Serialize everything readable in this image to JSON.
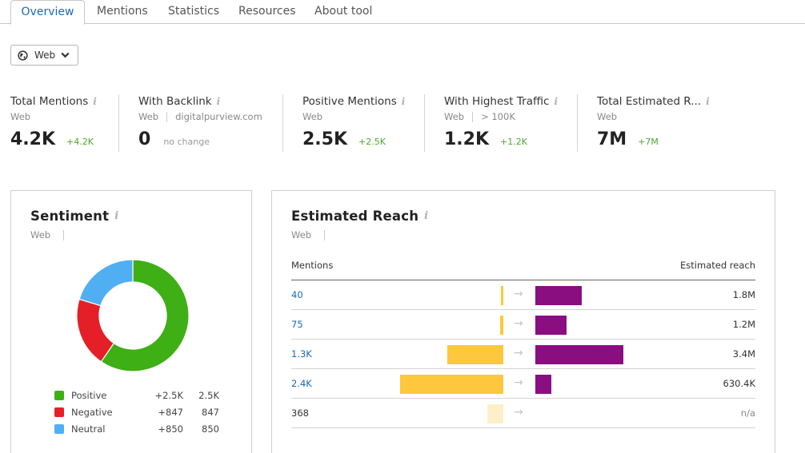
{
  "tabs": [
    {
      "label": "Overview",
      "active": true
    },
    {
      "label": "Mentions",
      "active": false
    },
    {
      "label": "Statistics",
      "active": false
    },
    {
      "label": "Resources",
      "active": false
    },
    {
      "label": "About tool",
      "active": false
    }
  ],
  "source_dropdown": {
    "icon": "globe-icon",
    "value": "Web"
  },
  "metrics": [
    {
      "title": "Total Mentions",
      "sub": [
        "Web"
      ],
      "value": "4.2K",
      "delta": "+4.2K"
    },
    {
      "title": "With Backlink",
      "sub": [
        "Web",
        "digitalpurview.com"
      ],
      "value": "0",
      "delta": "no change"
    },
    {
      "title": "Positive Mentions",
      "sub": [
        "Web"
      ],
      "value": "2.5K",
      "delta": "+2.5K"
    },
    {
      "title": "With Highest Traffic",
      "sub": [
        "Web",
        "> 100K"
      ],
      "value": "1.2K",
      "delta": "+1.2K"
    },
    {
      "title": "Total Estimated R...",
      "sub": [
        "Web"
      ],
      "value": "7M",
      "delta": "+7M"
    }
  ],
  "sentiment": {
    "title": "Sentiment",
    "sub": "Web",
    "colors": {
      "Positive": "#3eaf14",
      "Negative": "#e51f28",
      "Neutral": "#50aef3"
    },
    "legend": [
      {
        "name": "Positive",
        "delta": "+2.5K",
        "value": "2.5K"
      },
      {
        "name": "Negative",
        "delta": "+847",
        "value": "847"
      },
      {
        "name": "Neutral",
        "delta": "+850",
        "value": "850"
      }
    ]
  },
  "reach": {
    "title": "Estimated Reach",
    "sub": "Web",
    "header_left": "Mentions",
    "header_right": "Estimated reach",
    "colors": {
      "mentions": "#fec73d",
      "mentions_na": "#fdefc7",
      "reach": "#8a0e80"
    },
    "rows": [
      {
        "mentions": "40",
        "mentions_num": 40,
        "reach": "1.8M",
        "reach_num": 1800000,
        "link": true
      },
      {
        "mentions": "75",
        "mentions_num": 75,
        "reach": "1.2M",
        "reach_num": 1200000,
        "link": true
      },
      {
        "mentions": "1.3K",
        "mentions_num": 1300,
        "reach": "3.4M",
        "reach_num": 3400000,
        "link": true
      },
      {
        "mentions": "2.4K",
        "mentions_num": 2400,
        "reach": "630.4K",
        "reach_num": 630400,
        "link": true
      },
      {
        "mentions": "368",
        "mentions_num": 368,
        "reach": "n/a",
        "reach_num": null,
        "link": false
      }
    ]
  },
  "chart_data": [
    {
      "type": "pie",
      "title": "Sentiment",
      "categories": [
        "Positive",
        "Negative",
        "Neutral"
      ],
      "values": [
        2500,
        847,
        850
      ],
      "legend": "bottom"
    },
    {
      "type": "bar",
      "title": "Estimated Reach",
      "xlabel": "Mentions",
      "ylabel": "Estimated reach",
      "categories": [
        "40",
        "75",
        "1.3K",
        "2.4K",
        "368"
      ],
      "series": [
        {
          "name": "Mentions",
          "values": [
            40,
            75,
            1300,
            2400,
            368
          ]
        },
        {
          "name": "Estimated reach",
          "values": [
            1800000,
            1200000,
            3400000,
            630400,
            null
          ]
        }
      ]
    }
  ]
}
